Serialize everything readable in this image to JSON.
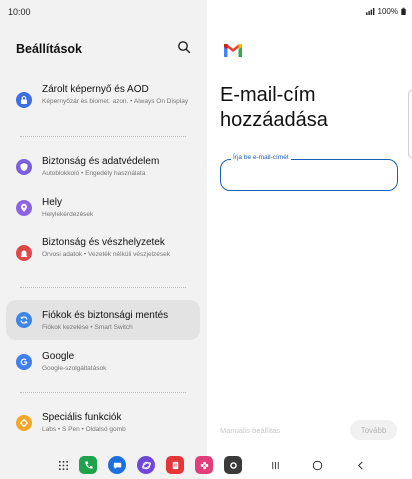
{
  "status_bar": {
    "time": "10:00",
    "battery": "100%"
  },
  "settings": {
    "title": "Beállítások",
    "items": [
      {
        "title": "Zárolt képernyő és AOD",
        "subtitle": "Képernyőzár és biomet. azon.  •  Always On Display",
        "icon": "lock-icon",
        "color": "#3e6fe5"
      },
      {
        "title": "Biztonság és adatvédelem",
        "subtitle": "Autoblokkoló  •  Engedély használata",
        "icon": "shield-icon",
        "color": "#7b5fe0"
      },
      {
        "title": "Hely",
        "subtitle": "Helylekérdezések",
        "icon": "location-icon",
        "color": "#8d63e6"
      },
      {
        "title": "Biztonság és vészhelyzetek",
        "subtitle": "Orvosi adatok  •  Vezeték nélküli vészjelzések",
        "icon": "emergency-icon",
        "color": "#e04848"
      },
      {
        "title": "Fiókok és biztonsági mentés",
        "subtitle": "Fiókok kezelése  •  Smart Switch",
        "icon": "sync-icon",
        "color": "#3e86e5"
      },
      {
        "title": "Google",
        "subtitle": "Google-szolgáltatások",
        "icon": "google-icon",
        "color": "#3e80f0"
      },
      {
        "title": "Speciális funkciók",
        "subtitle": "Labs  •  S Pen  •  Oldalsó gomb",
        "icon": "gear-plus-icon",
        "color": "#f2a72b"
      }
    ]
  },
  "email_setup": {
    "heading": "E-mail-cím hozzáadása",
    "input_label": "Írja be e-mail-címét",
    "input_value": "",
    "manual_settings": "Manuális beállítás",
    "next_label": "Tovább"
  },
  "taskbar": {
    "apps": [
      {
        "name": "phone-app-icon",
        "color": "#1fa34a"
      },
      {
        "name": "messages-app-icon",
        "color": "#1d6fe0"
      },
      {
        "name": "internet-app-icon",
        "color": "#6f48d8"
      },
      {
        "name": "notes-app-icon",
        "color": "#e5343a"
      },
      {
        "name": "gallery-app-icon",
        "color": "#e23f7a"
      },
      {
        "name": "camera-app-icon",
        "color": "#3a3a3a"
      }
    ]
  }
}
